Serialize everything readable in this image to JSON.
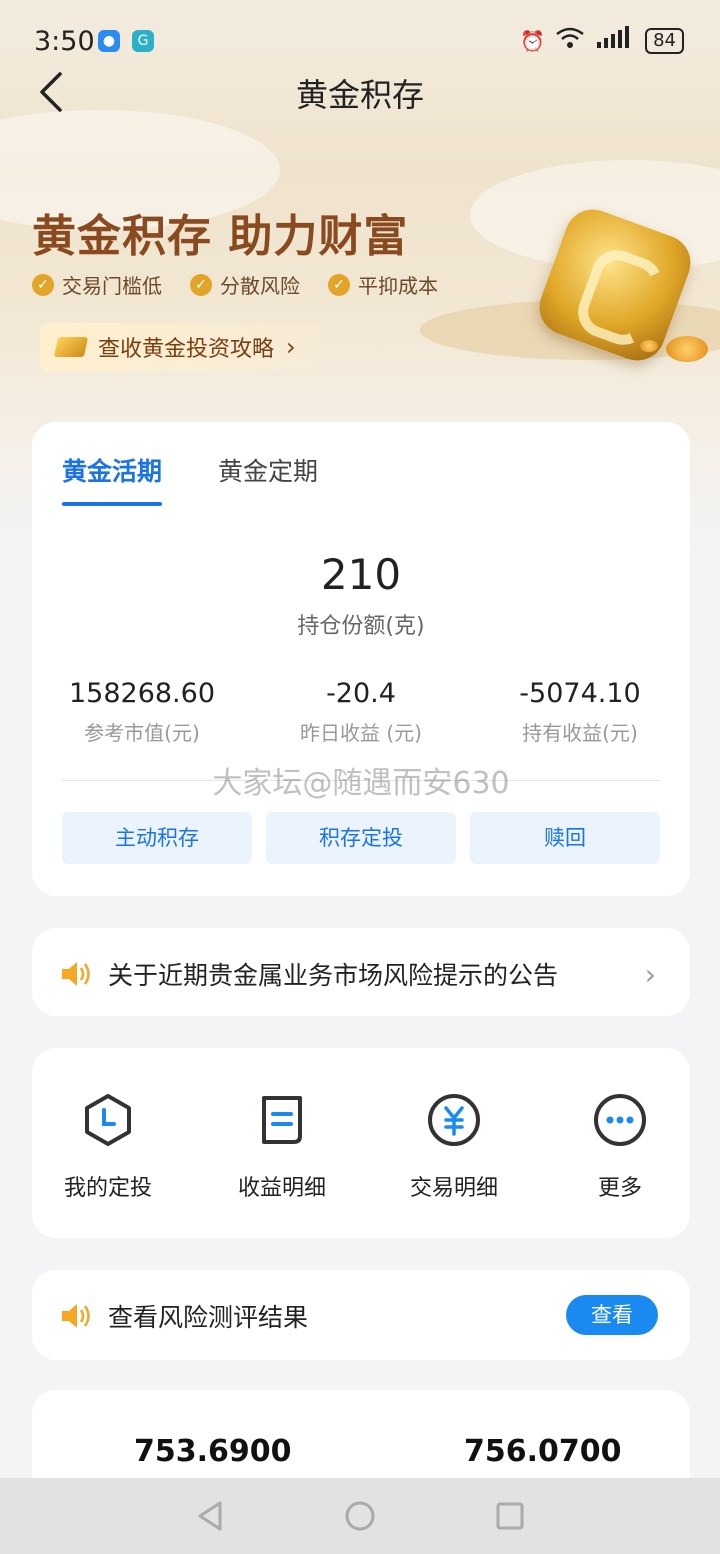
{
  "status": {
    "time": "3:50",
    "battery": "84",
    "signal": "6"
  },
  "header": {
    "title": "黄金积存"
  },
  "banner": {
    "slogan": "黄金积存 助力财富",
    "features": [
      "交易门槛低",
      "分散风险",
      "平抑成本"
    ],
    "guide_link": "查收黄金投资攻略"
  },
  "account_card": {
    "tabs": [
      {
        "label": "黄金活期",
        "active": true
      },
      {
        "label": "黄金定期",
        "active": false
      }
    ],
    "holding": {
      "value": "210",
      "label": "持仓份额(克)"
    },
    "stats": [
      {
        "value": "158268.60",
        "label": "参考市值(元)"
      },
      {
        "value": "-20.4",
        "label": "昨日收益 (元)"
      },
      {
        "value": "-5074.10",
        "label": "持有收益(元)"
      }
    ],
    "watermark": "大家坛@随遇而安630",
    "actions": [
      "主动积存",
      "积存定投",
      "赎回"
    ]
  },
  "notice": {
    "text": "关于近期贵金属业务市场风险提示的公告"
  },
  "quick_links": [
    {
      "label": "我的定投",
      "icon": "clock-hexagon-icon"
    },
    {
      "label": "收益明细",
      "icon": "document-icon"
    },
    {
      "label": "交易明细",
      "icon": "yuan-icon"
    },
    {
      "label": "更多",
      "icon": "more-icon"
    }
  ],
  "risk": {
    "text": "查看风险测评结果",
    "button": "查看"
  },
  "prices": {
    "left": "753.6900",
    "right": "756.0700"
  },
  "colors": {
    "accent": "#1a73e8",
    "brand_brown": "#8a4a1f",
    "gold": "#e3a529"
  }
}
